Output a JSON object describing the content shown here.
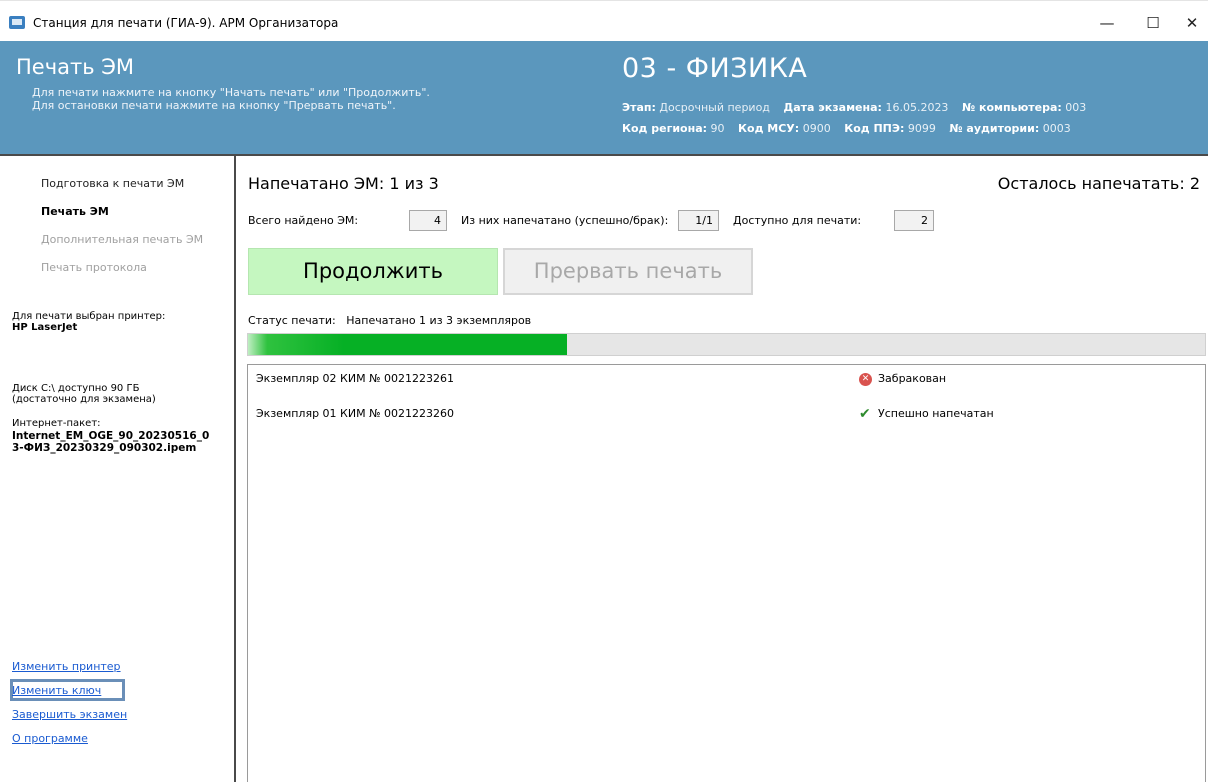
{
  "window": {
    "title": "Станция для печати (ГИА-9). АРМ Организатора",
    "controls": {
      "minimize": "—",
      "maximize": "☐",
      "close": "✕"
    }
  },
  "header": {
    "title": "Печать ЭМ",
    "hints": [
      "Для печати нажмите на кнопку \"Начать печать\" или \"Продолжить\".",
      "Для остановки печати нажмите на кнопку \"Прервать печать\"."
    ],
    "subject": "03 - ФИЗИКА",
    "meta": {
      "stage_label": "Этап:",
      "stage_value": "Досрочный период",
      "exam_date_label": "Дата экзамена:",
      "exam_date_value": "16.05.2023",
      "computer_label": "№ компьютера:",
      "computer_value": "003",
      "region_label": "Код региона:",
      "region_value": "90",
      "msu_label": "Код МСУ:",
      "msu_value": "0900",
      "ppe_label": "Код ППЭ:",
      "ppe_value": "9099",
      "room_label": "№ аудитории:",
      "room_value": "0003"
    }
  },
  "sidebar": {
    "nav": [
      {
        "label": "Подготовка к печати ЭМ",
        "state": "normal"
      },
      {
        "label": "Печать ЭМ",
        "state": "active"
      },
      {
        "label": "Дополнительная печать ЭМ",
        "state": "disabled"
      },
      {
        "label": "Печать протокола",
        "state": "disabled"
      }
    ],
    "printer_label": "Для печати выбран принтер:",
    "printer_name": "HP LaserJet",
    "disk_line1": "Диск C:\\ доступно 90 ГБ",
    "disk_line2": "(достаточно для экзамена)",
    "package_label": "Интернет-пакет:",
    "package_line1": "Internet_EM_OGE_90_20230516_0",
    "package_line2": "3-ФИЗ_20230329_090302.ipem",
    "links": {
      "change_printer": "Изменить принтер",
      "change_key": "Изменить ключ",
      "finish_exam": "Завершить экзамен",
      "about": "О программе"
    }
  },
  "main": {
    "printed_text": "Напечатано ЭМ:  1  из  3",
    "remaining_text": "Осталось напечатать: 2",
    "stats": {
      "total_label": "Всего найдено ЭМ:",
      "total_value": "4",
      "printed_label": "Из них напечатано (успешно/брак):",
      "printed_value": "1/1",
      "available_label": "Доступно для печати:",
      "available_value": "2"
    },
    "continue_button": "Продолжить",
    "stop_button": "Прервать печать",
    "status_label": "Статус печати:",
    "status_value": "Напечатано 1 из 3 экземпляров",
    "progress_fraction": 0.333,
    "items": [
      {
        "name": "Экземпляр 02  КИМ № 0021223261",
        "status": "Забракован",
        "icon": "reject-icon"
      },
      {
        "name": "Экземпляр 01  КИМ № 0021223260",
        "status": "Успешно напечатан",
        "icon": "checkmark-icon"
      }
    ]
  },
  "colors": {
    "header_bg": "#5b97bd",
    "continue_bg": "#c5f7c0",
    "progress_fill": "#06b025",
    "link": "#1a5bd1"
  }
}
